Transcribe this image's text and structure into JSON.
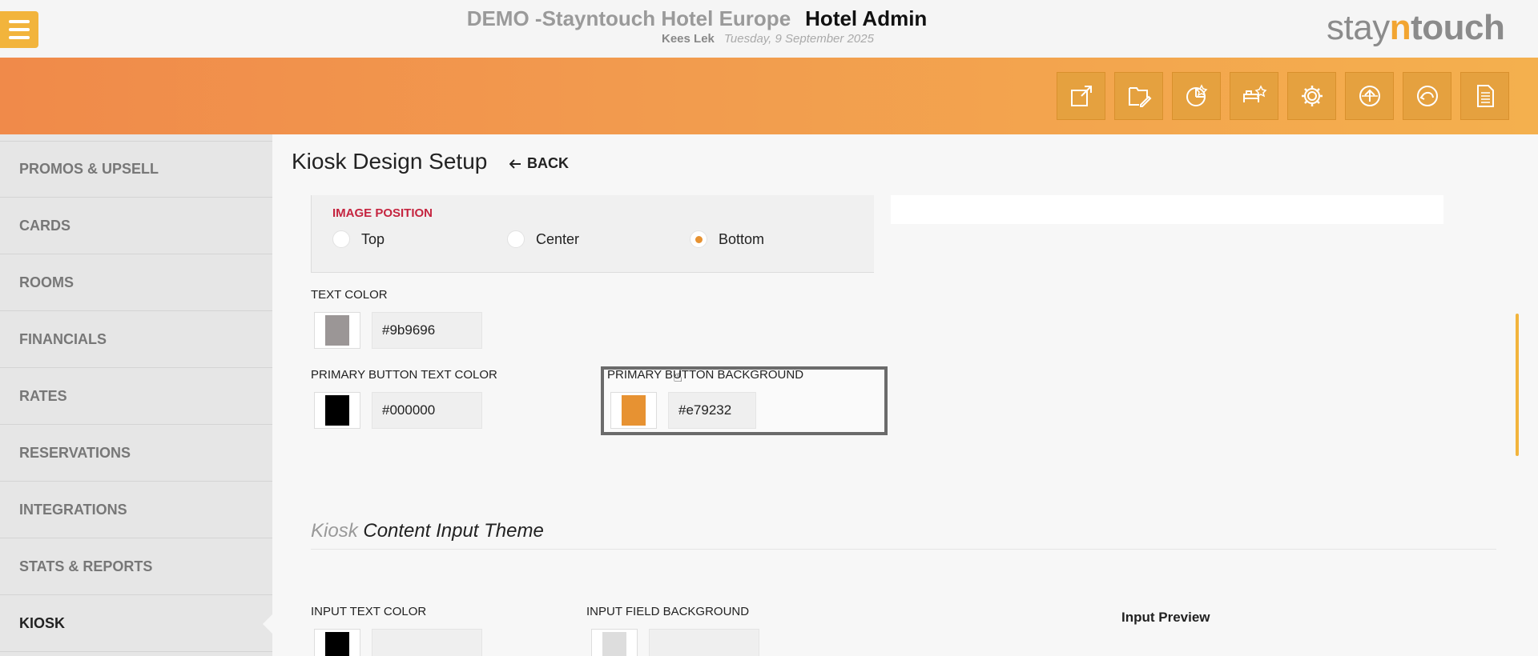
{
  "header": {
    "hotel_name": "DEMO -Stayntouch Hotel Europe",
    "admin_label": "Hotel Admin",
    "user": "Kees Lek",
    "date": "Tuesday, 9 September 2025",
    "brand_stay": "stay",
    "brand_n": "n",
    "brand_touch": "touch"
  },
  "toolbar": {
    "icons": [
      "external-link-icon",
      "edit-document-icon",
      "dashboard-chart-icon",
      "housekeeping-icon",
      "gear-icon",
      "upload-icon",
      "undo-icon",
      "report-icon"
    ]
  },
  "sidebar": {
    "items": [
      {
        "label": "PROMOS & UPSELL"
      },
      {
        "label": "CARDS"
      },
      {
        "label": "ROOMS"
      },
      {
        "label": "FINANCIALS"
      },
      {
        "label": "RATES"
      },
      {
        "label": "RESERVATIONS"
      },
      {
        "label": "INTEGRATIONS"
      },
      {
        "label": "STATS & REPORTS"
      },
      {
        "label": "KIOSK"
      }
    ],
    "active": "KIOSK"
  },
  "main": {
    "title": "Kiosk Design Setup",
    "back_label": "BACK",
    "image_position": {
      "label": "IMAGE POSITION",
      "options": [
        "Top",
        "Center",
        "Bottom"
      ],
      "selected": "Bottom"
    },
    "text_color": {
      "label": "TEXT COLOR",
      "value": "#9b9696",
      "swatch": "#9b9696"
    },
    "primary_button_text_color": {
      "label": "PRIMARY BUTTON TEXT COLOR",
      "value": "#000000",
      "swatch": "#000000"
    },
    "primary_button_background": {
      "label": "PRIMARY BUTTON BACKGROUND",
      "value": "#e79232",
      "swatch": "#e79232"
    },
    "content_input_theme": {
      "prefix": "Kiosk",
      "title": "Content Input Theme"
    },
    "input_text_color": {
      "label": "INPUT TEXT COLOR",
      "swatch": "#000000"
    },
    "input_field_background": {
      "label": "INPUT FIELD BACKGROUND",
      "swatch": "#dddddd"
    },
    "input_preview_label": "Input Preview"
  },
  "colors": {
    "accent": "#f2b43c",
    "selected_radio": "#e79232",
    "section_label": "#c5243f"
  }
}
